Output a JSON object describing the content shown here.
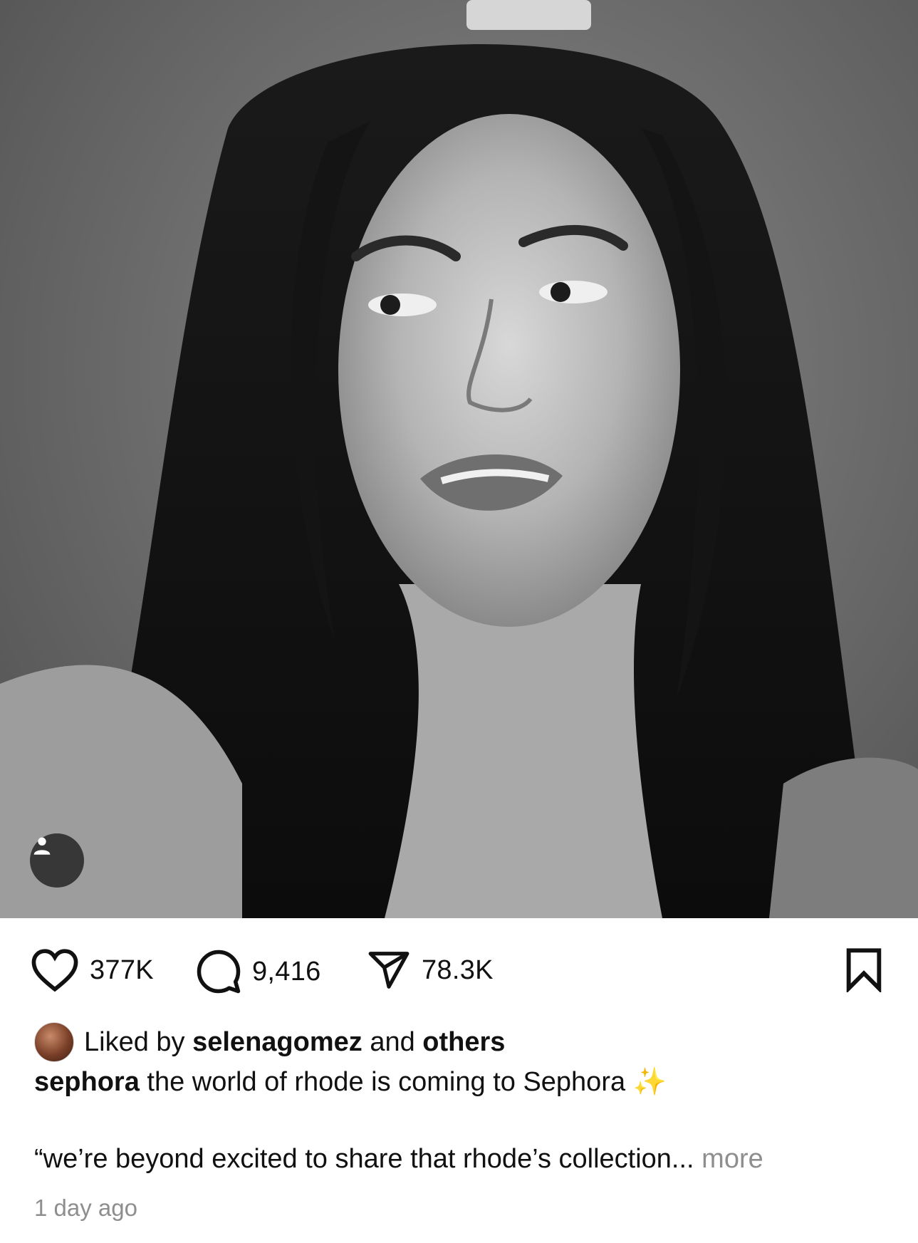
{
  "post": {
    "image_alt": "Black and white portrait photo",
    "tag_icon": "person-tag-icon"
  },
  "actions": {
    "likes": "377K",
    "comments": "9,416",
    "shares": "78.3K",
    "like_icon": "heart-icon",
    "comment_icon": "comment-bubble-icon",
    "share_icon": "paper-plane-icon",
    "save_icon": "bookmark-icon"
  },
  "liked_by": {
    "prefix": "Liked by",
    "user": "selenagomez",
    "conj": "and",
    "others": "others"
  },
  "caption": {
    "username": "sephora",
    "text": "the world of rhode is coming to Sephora",
    "emoji": "✨",
    "second_line": "“we’re beyond excited to share that rhode’s collection...",
    "more": "more"
  },
  "timestamp": "1 day ago"
}
